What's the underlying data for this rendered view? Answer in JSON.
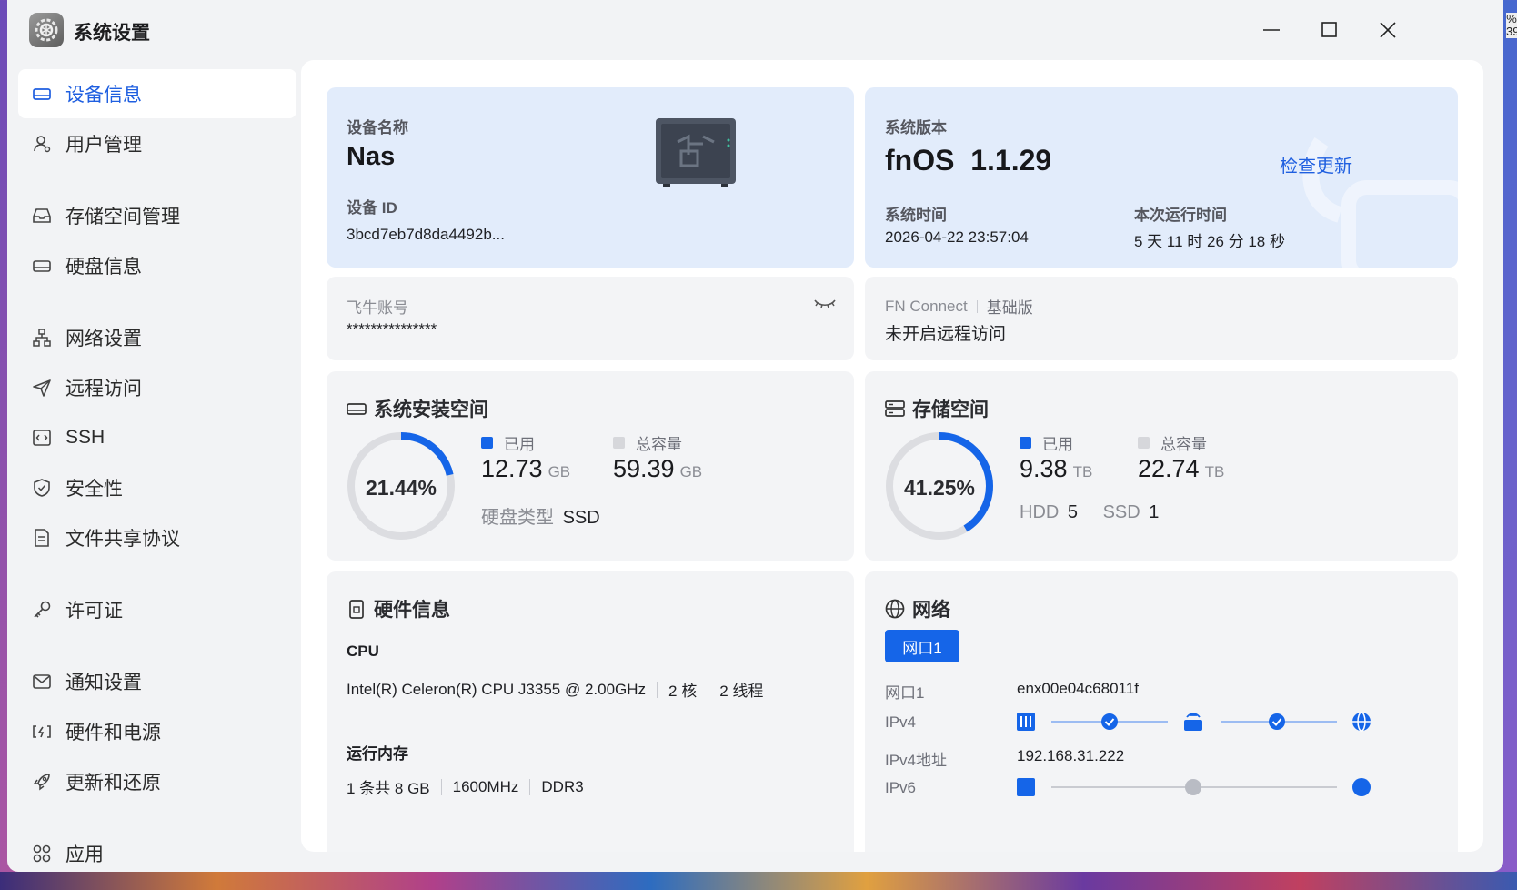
{
  "window": {
    "title": "系统设置"
  },
  "desktop": {
    "edge_text": "%\n39"
  },
  "sidebar": {
    "items": [
      {
        "label": "设备信息",
        "icon": "device-icon",
        "active": true
      },
      {
        "label": "用户管理",
        "icon": "user-icon"
      },
      {
        "label": "存储空间管理",
        "icon": "storage-icon"
      },
      {
        "label": "硬盘信息",
        "icon": "disk-icon"
      },
      {
        "label": "网络设置",
        "icon": "network-icon"
      },
      {
        "label": "远程访问",
        "icon": "send-icon"
      },
      {
        "label": "SSH",
        "icon": "ssh-icon"
      },
      {
        "label": "安全性",
        "icon": "shield-icon"
      },
      {
        "label": "文件共享协议",
        "icon": "file-icon"
      },
      {
        "label": "许可证",
        "icon": "key-icon"
      },
      {
        "label": "通知设置",
        "icon": "mail-icon"
      },
      {
        "label": "硬件和电源",
        "icon": "power-icon"
      },
      {
        "label": "更新和还原",
        "icon": "rocket-icon"
      },
      {
        "label": "应用",
        "icon": "apps-icon"
      }
    ]
  },
  "device": {
    "name_label": "设备名称",
    "name": "Nas",
    "id_label": "设备 ID",
    "id": "3bcd7eb7d8da4492b..."
  },
  "system": {
    "version_label": "系统版本",
    "version": "fnOS  1.1.29",
    "check_update": "检查更新",
    "time_label": "系统时间",
    "time": "2026-04-22 23:57:04",
    "uptime_label": "本次运行时间",
    "uptime": "5 天 11 时 26 分 18 秒"
  },
  "account": {
    "label": "飞牛账号",
    "value": "***************"
  },
  "connect": {
    "label": "FN Connect",
    "edition": "基础版",
    "status": "未开启远程访问"
  },
  "install_space": {
    "title": "系统安装空间",
    "percent_text": "21.44%",
    "percent": 21.44,
    "used_label": "已用",
    "used": "12.73",
    "used_unit": "GB",
    "total_label": "总容量",
    "total": "59.39",
    "total_unit": "GB",
    "disk_type_label": "硬盘类型",
    "disk_type": "SSD"
  },
  "storage": {
    "title": "存储空间",
    "percent_text": "41.25%",
    "percent": 41.25,
    "used_label": "已用",
    "used": "9.38",
    "used_unit": "TB",
    "total_label": "总容量",
    "total": "22.74",
    "total_unit": "TB",
    "hdd_label": "HDD",
    "hdd_count": "5",
    "ssd_label": "SSD",
    "ssd_count": "1"
  },
  "hardware": {
    "title": "硬件信息",
    "cpu_label": "CPU",
    "cpu_model": "Intel(R) Celeron(R) CPU J3355 @ 2.00GHz",
    "cores": "2 核",
    "threads": "2 线程",
    "memory_label": "运行内存",
    "memory_size": "1 条共 8 GB",
    "memory_freq": "1600MHz",
    "memory_type": "DDR3"
  },
  "network": {
    "title": "网络",
    "port_tab": "网口1",
    "port_label": "网口1",
    "port_name": "enx00e04c68011f",
    "ipv4_label": "IPv4",
    "ipv4_addr_label": "IPv4地址",
    "ipv4_addr": "192.168.31.222",
    "ipv6_label": "IPv6"
  },
  "colors": {
    "accent": "#1565e8",
    "used": "#1565e8",
    "total": "#d6d7db",
    "ring_track": "#dcdde1"
  }
}
